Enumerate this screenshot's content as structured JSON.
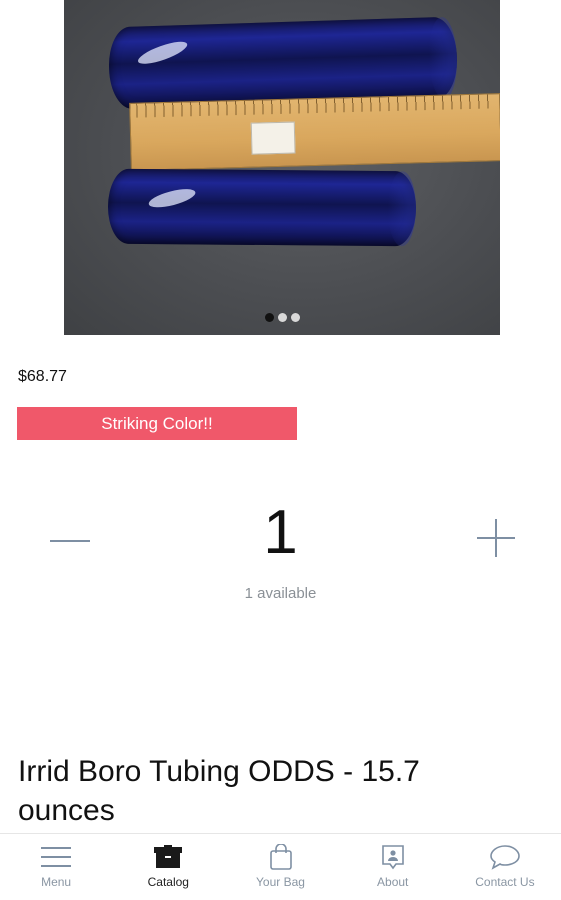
{
  "product": {
    "price": "$68.77",
    "badge": "Striking Color!!",
    "title": "Irrid Boro Tubing ODDS - 15.7 ounces",
    "image_dots": 3,
    "active_image": 1
  },
  "quantity": {
    "value": "1",
    "available": "1 available"
  },
  "nav": {
    "items": [
      {
        "label": "Menu",
        "icon": "hamburger-icon"
      },
      {
        "label": "Catalog",
        "icon": "catalog-icon",
        "active": true
      },
      {
        "label": "Your Bag",
        "icon": "bag-icon"
      },
      {
        "label": "About",
        "icon": "about-icon"
      },
      {
        "label": "Contact Us",
        "icon": "chat-icon"
      }
    ]
  },
  "colors": {
    "badge": "#f0586a",
    "accent_icon": "#7e8fa3",
    "text": "#111111"
  }
}
